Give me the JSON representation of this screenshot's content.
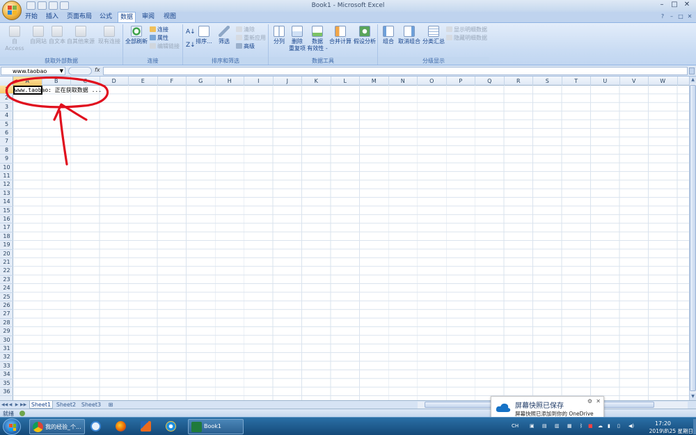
{
  "window": {
    "title": "Book1 - Microsoft Excel",
    "controls": [
      "–",
      "□",
      "✕"
    ]
  },
  "tabs": [
    {
      "label": "开始",
      "active": false
    },
    {
      "label": "插入",
      "active": false
    },
    {
      "label": "页面布局",
      "active": false
    },
    {
      "label": "公式",
      "active": false
    },
    {
      "label": "数据",
      "active": true
    },
    {
      "label": "审阅",
      "active": false
    },
    {
      "label": "视图",
      "active": false
    }
  ],
  "ribbon": {
    "get_external": {
      "label": "获取外部数据",
      "buttons": [
        "自 Access",
        "自网站",
        "自文本",
        "自其他来源",
        "现有连接"
      ]
    },
    "connections": {
      "label": "连接",
      "refresh_all": "全部刷新",
      "connections": "连接",
      "properties": "属性",
      "edit_links": "编辑链接"
    },
    "sort_filter": {
      "label": "排序和筛选",
      "sort": "排序...",
      "filter": "筛选",
      "clear": "清除",
      "reapply": "重新应用",
      "advanced": "高级"
    },
    "data_tools": {
      "label": "数据工具",
      "text_to_columns": "分列",
      "remove_duplicates_1": "删除",
      "remove_duplicates_2": "重复项",
      "validation_1": "数据",
      "validation_2": "有效性 -",
      "consolidate": "合并计算",
      "what_if": "假设分析"
    },
    "outline": {
      "label": "分级显示",
      "group": "组合",
      "ungroup": "取消组合",
      "subtotal": "分类汇总",
      "show_detail": "显示明细数据",
      "hide_detail": "隐藏明细数据"
    }
  },
  "formula_bar": {
    "name_box": "www.taobao",
    "fx": "fx",
    "value": ""
  },
  "grid": {
    "columns": [
      "A",
      "B",
      "C",
      "D",
      "E",
      "F",
      "G",
      "H",
      "I",
      "J",
      "K",
      "L",
      "M",
      "N",
      "O",
      "P",
      "Q",
      "R",
      "S",
      "T",
      "U",
      "V",
      "W"
    ],
    "rows": [
      "1",
      "2",
      "3",
      "4",
      "5",
      "6",
      "7",
      "8",
      "9",
      "10",
      "11",
      "12",
      "13",
      "14",
      "15",
      "16",
      "17",
      "18",
      "19",
      "20",
      "21",
      "22",
      "23",
      "24",
      "25",
      "26",
      "27",
      "28",
      "29",
      "30",
      "31",
      "32",
      "33",
      "34",
      "35",
      "36"
    ],
    "selected_column": "A",
    "selected_row": "1",
    "cell_a1_text": "www.taobao: 正在获取数据 ..."
  },
  "sheet_tabs": [
    "Sheet1",
    "Sheet2",
    "Sheet3"
  ],
  "status": {
    "text": "就绪"
  },
  "notification": {
    "title": "屏幕快照已保存",
    "body": "屏幕快照已添加到你的 OneDrive"
  },
  "taskbar": {
    "items": [
      {
        "label": "我的经验_个..."
      },
      {
        "label": "Book1"
      }
    ],
    "time": "17:20",
    "date": "2019\\8\\25 星期日",
    "tray_text": "CH"
  },
  "colors": {
    "annotation": "#e0101e",
    "ribbon_text": "#15428b",
    "selected_header": "#f8c86c"
  }
}
